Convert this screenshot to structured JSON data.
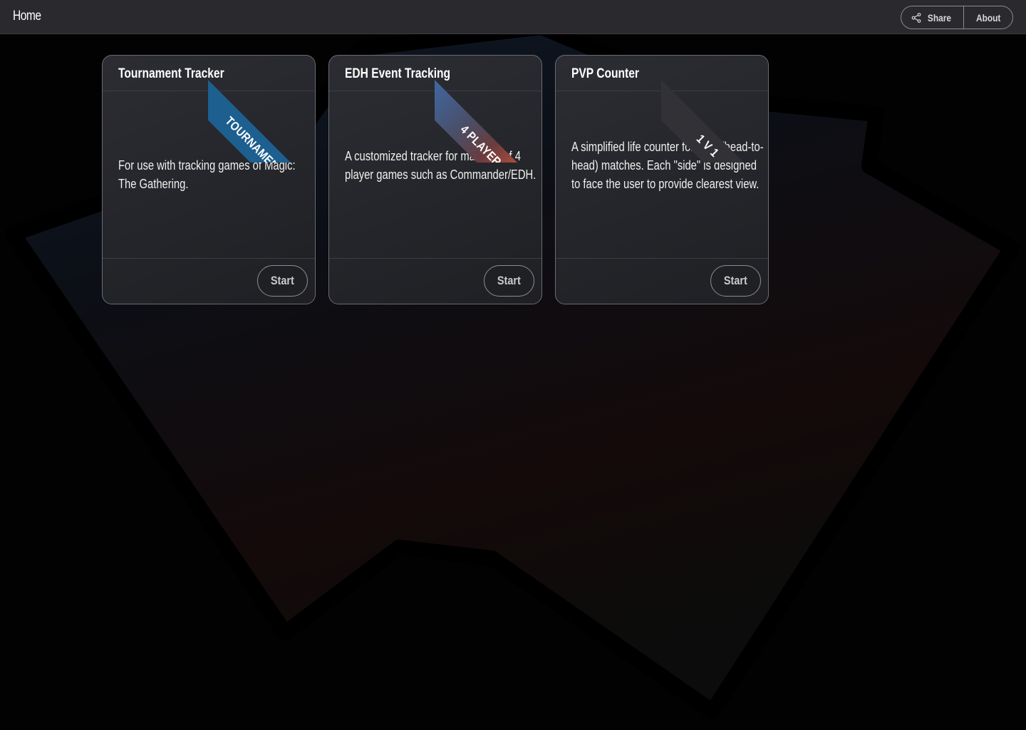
{
  "topbar": {
    "title": "Home",
    "share_label": "Share",
    "about_label": "About"
  },
  "cards": [
    {
      "title": "Tournament Tracker",
      "ribbon": "TOURNAMENT",
      "description": "For use with tracking games of Magic: The Gathering.",
      "start_label": "Start"
    },
    {
      "title": "EDH Event Tracking",
      "ribbon": "4 PLAYER",
      "description": "A customized tracker for matches of 4 player games such as Commander/EDH.",
      "start_label": "Start"
    },
    {
      "title": "PVP Counter",
      "ribbon": "1 V 1",
      "description": "A simplified life counter for PVP (head-to-head) matches. Each \"side\" is designed to face the user to provide clearest view.",
      "start_label": "Start"
    }
  ],
  "icons": {
    "share": "share-icon"
  },
  "colors": {
    "topbar_bg": "#2a2a2e",
    "page_bg": "#020203",
    "ribbon_tournament": "#1d5f8f",
    "ribbon_pvp": "#323236"
  }
}
